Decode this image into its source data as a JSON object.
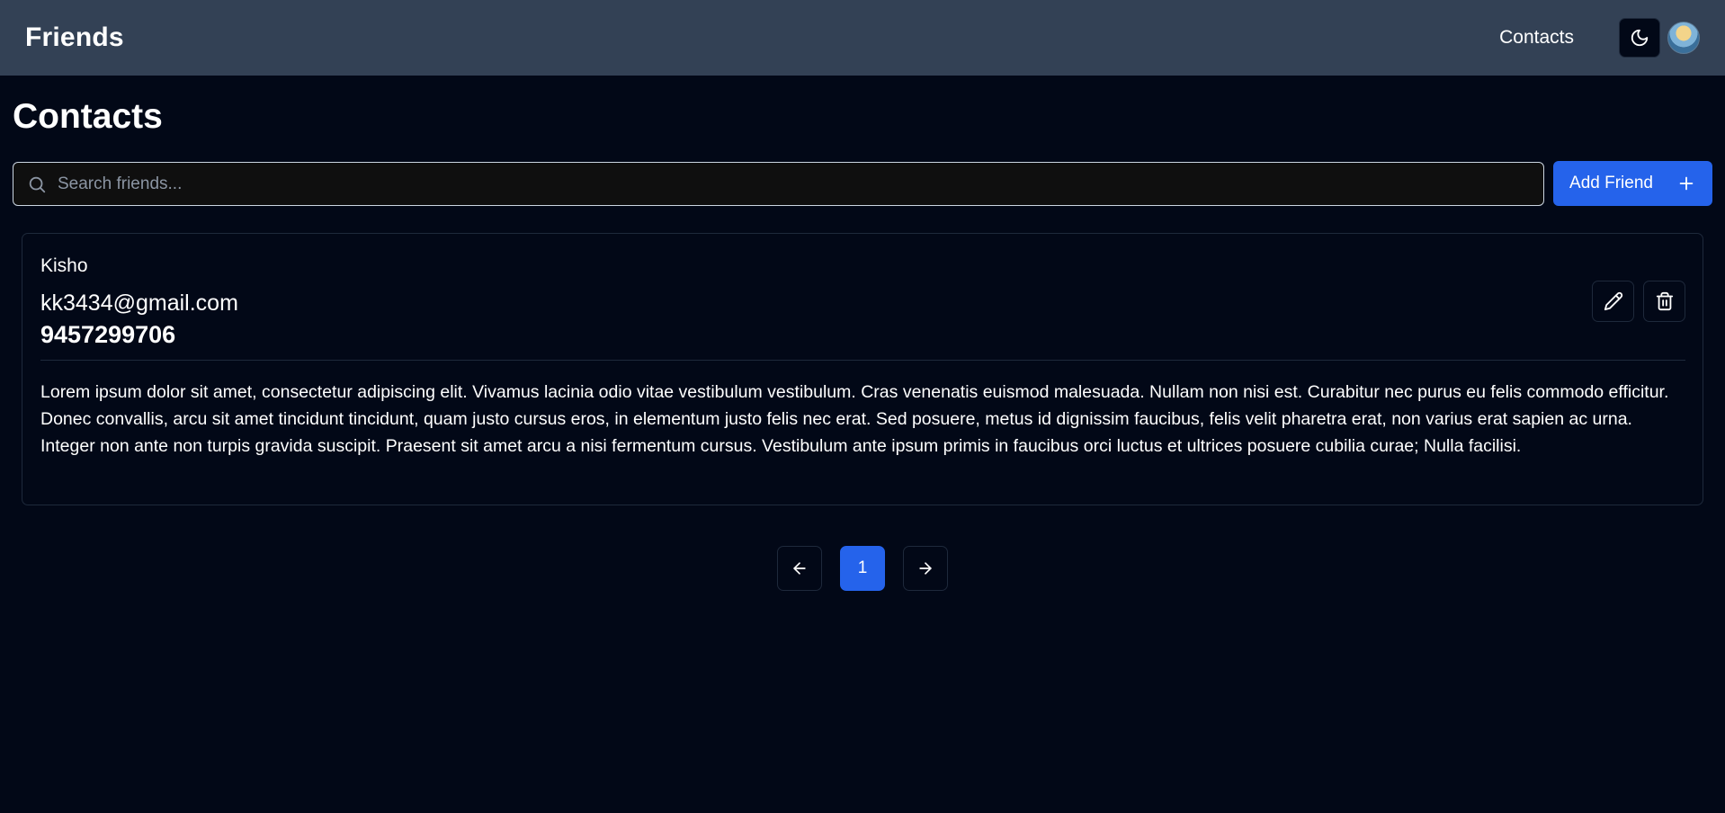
{
  "header": {
    "brand": "Friends",
    "nav": [
      {
        "label": "Contacts"
      }
    ],
    "theme_toggle_icon": "moon-icon",
    "avatar_icon": "user-avatar"
  },
  "main": {
    "title": "Contacts",
    "search": {
      "placeholder": "Search friends...",
      "value": "",
      "icon": "search-icon"
    },
    "add_button": {
      "label": "Add Friend",
      "icon": "plus-icon"
    }
  },
  "contacts": [
    {
      "name": "Kisho",
      "email": "kk3434@gmail.com",
      "phone": "9457299706",
      "description": "Lorem ipsum dolor sit amet, consectetur adipiscing elit. Vivamus lacinia odio vitae vestibulum vestibulum. Cras venenatis euismod malesuada. Nullam non nisi est. Curabitur nec purus eu felis commodo efficitur. Donec convallis, arcu sit amet tincidunt tincidunt, quam justo cursus eros, in elementum justo felis nec erat. Sed posuere, metus id dignissim faucibus, felis velit pharetra erat, non varius erat sapien ac urna. Integer non ante non turpis gravida suscipit. Praesent sit amet arcu a nisi fermentum cursus. Vestibulum ante ipsum primis in faucibus orci luctus et ultrices posuere cubilia curae; Nulla facilisi.",
      "actions": [
        "pencil-icon",
        "trash-icon"
      ]
    }
  ],
  "pagination": {
    "current_page": "1",
    "prev_icon": "arrow-left-icon",
    "next_icon": "arrow-right-icon"
  },
  "colors": {
    "background": "#020817",
    "header": "#334155",
    "accent": "#2563eb",
    "border": "#1e293b"
  }
}
